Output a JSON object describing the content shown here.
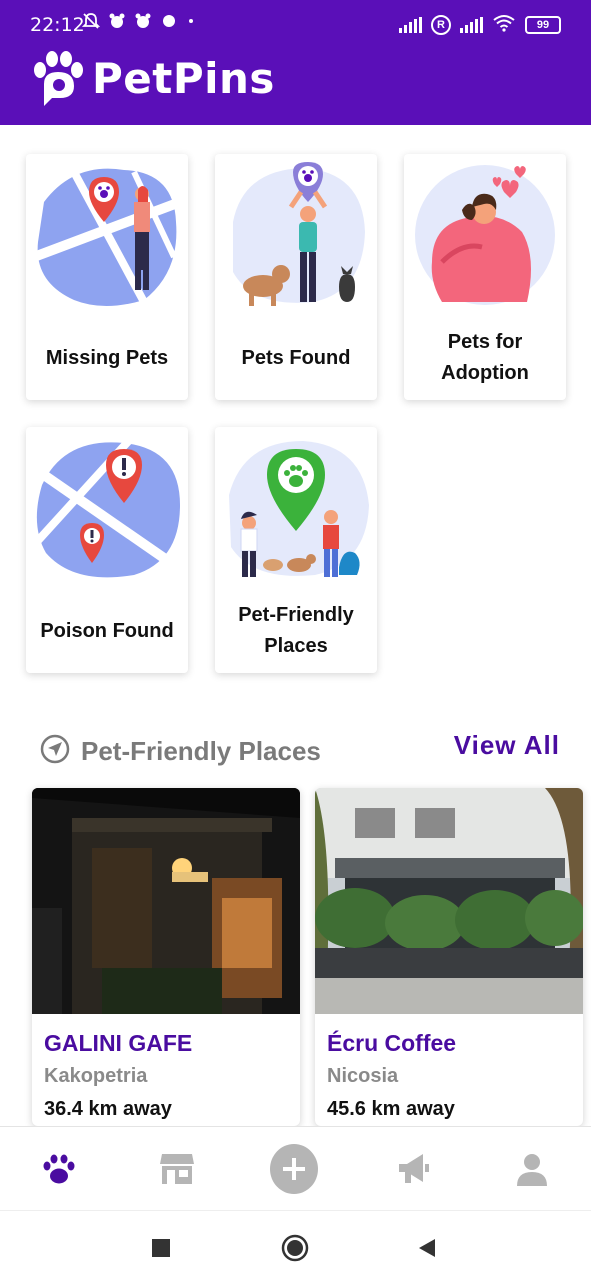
{
  "status_bar": {
    "time": "22:12",
    "battery": "99"
  },
  "header": {
    "brand_name": "PetPins",
    "brand_color": "#5a0fb8"
  },
  "categories": [
    {
      "label": "Missing Pets",
      "icon": "map-pin-paw-icon"
    },
    {
      "label": "Pets Found",
      "icon": "person-holding-pin-icon"
    },
    {
      "label": "Pets for Adoption",
      "icon": "person-hugging-pet-icon"
    },
    {
      "label": "Poison Found",
      "icon": "map-warning-pin-icon"
    },
    {
      "label": "Pet-Friendly Places",
      "icon": "green-paw-pin-icon"
    }
  ],
  "places_section": {
    "title": "Pet-Friendly Places",
    "view_all": "View All",
    "accent": "#4a0ca0"
  },
  "places": [
    {
      "name": "GALINI GAFE",
      "city": "Kakopetria",
      "distance": "36.4 km away"
    },
    {
      "name": "Écru Coffee",
      "city": "Nicosia",
      "distance": "45.6 km away"
    }
  ],
  "bottom_nav": [
    {
      "icon": "paw-icon",
      "active": true
    },
    {
      "icon": "store-icon",
      "active": false
    },
    {
      "icon": "add-icon",
      "active": false
    },
    {
      "icon": "megaphone-icon",
      "active": false
    },
    {
      "icon": "user-icon",
      "active": false
    }
  ]
}
